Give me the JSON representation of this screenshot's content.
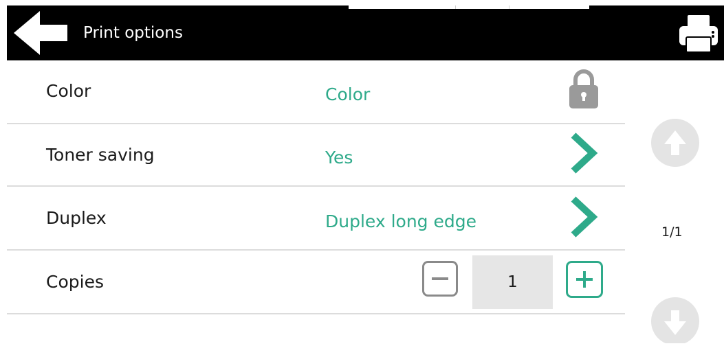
{
  "header": {
    "title": "Print options",
    "background_color": "#000000",
    "back_icon": "arrow-left-icon",
    "printer_icon": "printer-icon"
  },
  "rows": [
    {
      "label": "Color",
      "value": "Color",
      "action": "lock-icon"
    },
    {
      "label": "Toner saving",
      "value": "Yes",
      "action": "chevron-right-icon"
    },
    {
      "label": "Duplex",
      "value": "Duplex long edge",
      "action": "chevron-right-icon"
    },
    {
      "label": "Copies",
      "value": "1",
      "action": "stepper"
    }
  ],
  "stepper": {
    "minus_icon": "minus-icon",
    "plus_icon": "plus-icon",
    "value": "1"
  },
  "pagination": {
    "indicator": "1/1",
    "up_icon": "arrow-up-icon",
    "down_icon": "arrow-down-icon"
  },
  "colors": {
    "accent": "#2eaa8a",
    "locked_gray": "#9a9a9a",
    "disabled_gray": "#e4e4e4",
    "divider": "#dcdcdc"
  }
}
